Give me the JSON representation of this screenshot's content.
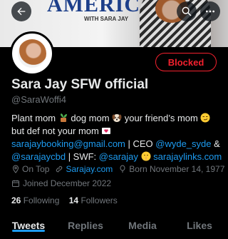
{
  "banner": {
    "title": "AMERICA",
    "subtitle": "WITH SARA JAY"
  },
  "header": {
    "back_icon": "arrow-left-icon",
    "search_icon": "search-icon",
    "more_icon": "more-icon"
  },
  "profile": {
    "name": "Sara Jay SFW official",
    "handle": "@SaraWoffi4",
    "blocked_label": "Blocked",
    "bio": {
      "line1_a": "Plant mom ",
      "line1_b": " dog mom ",
      "line1_c": " your friend’s mom ",
      "line2": "but def not your mom ",
      "email": "sarajaybooking@gmail.com",
      "ceo_text": " | CEO ",
      "ceo_handle": "@wyde_syde",
      "amp": " &",
      "cbd_handle": "@sarajaycbd",
      "swf_text": " | SWF: ",
      "swf_handle": "@sarajay",
      "links": "sarajaylinks.com"
    },
    "location": "On Top",
    "website": "Sarajay.com",
    "born": "Born November 14, 1977",
    "joined": "Joined December 2022",
    "following_count": "26",
    "following_label": "Following",
    "followers_count": "14",
    "followers_label": "Followers"
  },
  "tabs": [
    {
      "label": "Tweets"
    },
    {
      "label": "Replies"
    },
    {
      "label": "Media"
    },
    {
      "label": "Likes"
    }
  ],
  "colors": {
    "accent": "#1d9bf0",
    "blocked": "#f4212e",
    "muted": "#71767b"
  }
}
